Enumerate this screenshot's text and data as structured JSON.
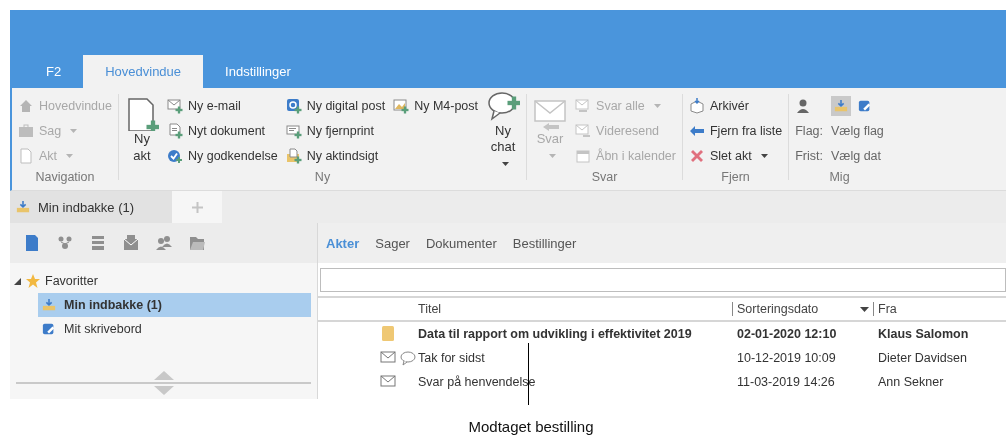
{
  "tabs": [
    {
      "label": "F2",
      "selected": false
    },
    {
      "label": "Hovedvindue",
      "selected": true
    },
    {
      "label": "Indstillinger",
      "selected": false
    }
  ],
  "ribbon": {
    "groups": [
      {
        "label": "Navigation",
        "items": [
          {
            "kind": "small",
            "label": "Hovedvindue",
            "disabled": true,
            "dropdown": false
          },
          {
            "kind": "small",
            "label": "Sag",
            "disabled": true,
            "dropdown": true
          },
          {
            "kind": "small",
            "label": "Akt",
            "disabled": true,
            "dropdown": true
          }
        ]
      },
      {
        "label": "Ny",
        "items": [
          {
            "kind": "large",
            "label": "Ny akt",
            "disabled": false,
            "dropdown": false
          },
          {
            "kind": "small",
            "label": "Ny e-mail",
            "disabled": false,
            "dropdown": false
          },
          {
            "kind": "small",
            "label": "Nyt dokument",
            "disabled": false,
            "dropdown": false
          },
          {
            "kind": "small",
            "label": "Ny godkendelse",
            "disabled": false,
            "dropdown": false
          },
          {
            "kind": "small",
            "label": "Ny digital post",
            "disabled": false,
            "dropdown": false
          },
          {
            "kind": "small",
            "label": "Ny fjernprint",
            "disabled": false,
            "dropdown": false
          },
          {
            "kind": "small",
            "label": "Ny aktindsigt",
            "disabled": false,
            "dropdown": false
          },
          {
            "kind": "small",
            "label": "Ny M4-post",
            "disabled": false,
            "dropdown": false
          },
          {
            "kind": "large",
            "label": "Ny chat",
            "disabled": false,
            "dropdown": true
          }
        ]
      },
      {
        "label": "Svar",
        "items": [
          {
            "kind": "large",
            "label": "Svar",
            "disabled": true,
            "dropdown": true
          },
          {
            "kind": "small",
            "label": "Svar alle",
            "disabled": true,
            "dropdown": true
          },
          {
            "kind": "small",
            "label": "Videresend",
            "disabled": true,
            "dropdown": false
          },
          {
            "kind": "small",
            "label": "Åbn i kalender",
            "disabled": true,
            "dropdown": false
          }
        ]
      },
      {
        "label": "Fjern",
        "items": [
          {
            "kind": "small",
            "label": "Arkivér",
            "disabled": false,
            "dropdown": false
          },
          {
            "kind": "small",
            "label": "Fjern fra liste",
            "disabled": false,
            "dropdown": false
          },
          {
            "kind": "small",
            "label": "Slet akt",
            "disabled": false,
            "dropdown": true
          }
        ]
      },
      {
        "label": "Mig",
        "items": [
          {
            "kind": "icon"
          },
          {
            "kind": "caption",
            "label": "Flag:"
          },
          {
            "kind": "caption",
            "label": "Frist:"
          },
          {
            "kind": "toggles",
            "toggles": [
              {
                "selected": true
              },
              {
                "selected": false
              }
            ]
          },
          {
            "kind": "value",
            "label": "Vælg flag"
          },
          {
            "kind": "value",
            "label": "Vælg dat"
          }
        ]
      }
    ]
  },
  "doc_tabs": [
    {
      "label": "Min indbakke (1)",
      "selected": true
    }
  ],
  "sidebar": {
    "toolbar": [
      {
        "selected": true
      },
      {
        "selected": false
      },
      {
        "selected": false
      },
      {
        "selected": false
      },
      {
        "selected": false
      },
      {
        "selected": false
      }
    ],
    "tree": [
      {
        "label": "Favoritter",
        "expanded": true,
        "selected": false,
        "children": [
          {
            "label": "Min indbakke (1)",
            "selected": true
          },
          {
            "label": "Mit skrivebord",
            "selected": false
          }
        ]
      }
    ]
  },
  "content_tabs": [
    {
      "label": "Akter",
      "selected": true
    },
    {
      "label": "Sager",
      "selected": false
    },
    {
      "label": "Dokumenter",
      "selected": false
    },
    {
      "label": "Bestillinger",
      "selected": false
    }
  ],
  "table": {
    "columns": [
      {
        "label": "Titel",
        "sorted": false
      },
      {
        "label": "Sorteringsdato",
        "sorted": true
      },
      {
        "label": "Fra",
        "sorted": false
      }
    ],
    "rows": [
      {
        "kind": "document",
        "unread": true,
        "comment": false,
        "title": "Data til rapport om udvikling i effektivitet 2019",
        "date": "02-01-2020 12:10",
        "from": "Klaus Salomon"
      },
      {
        "kind": "mail",
        "unread": false,
        "comment": true,
        "title": "Tak for sidst",
        "date": "10-12-2019 10:09",
        "from": "Dieter Davidsen"
      },
      {
        "kind": "mail",
        "unread": false,
        "comment": false,
        "title": "Svar på henvendelse",
        "date": "11-03-2019 14:26",
        "from": "Ann Sekner"
      }
    ]
  },
  "annotation": {
    "label": "Modtaget bestilling"
  }
}
